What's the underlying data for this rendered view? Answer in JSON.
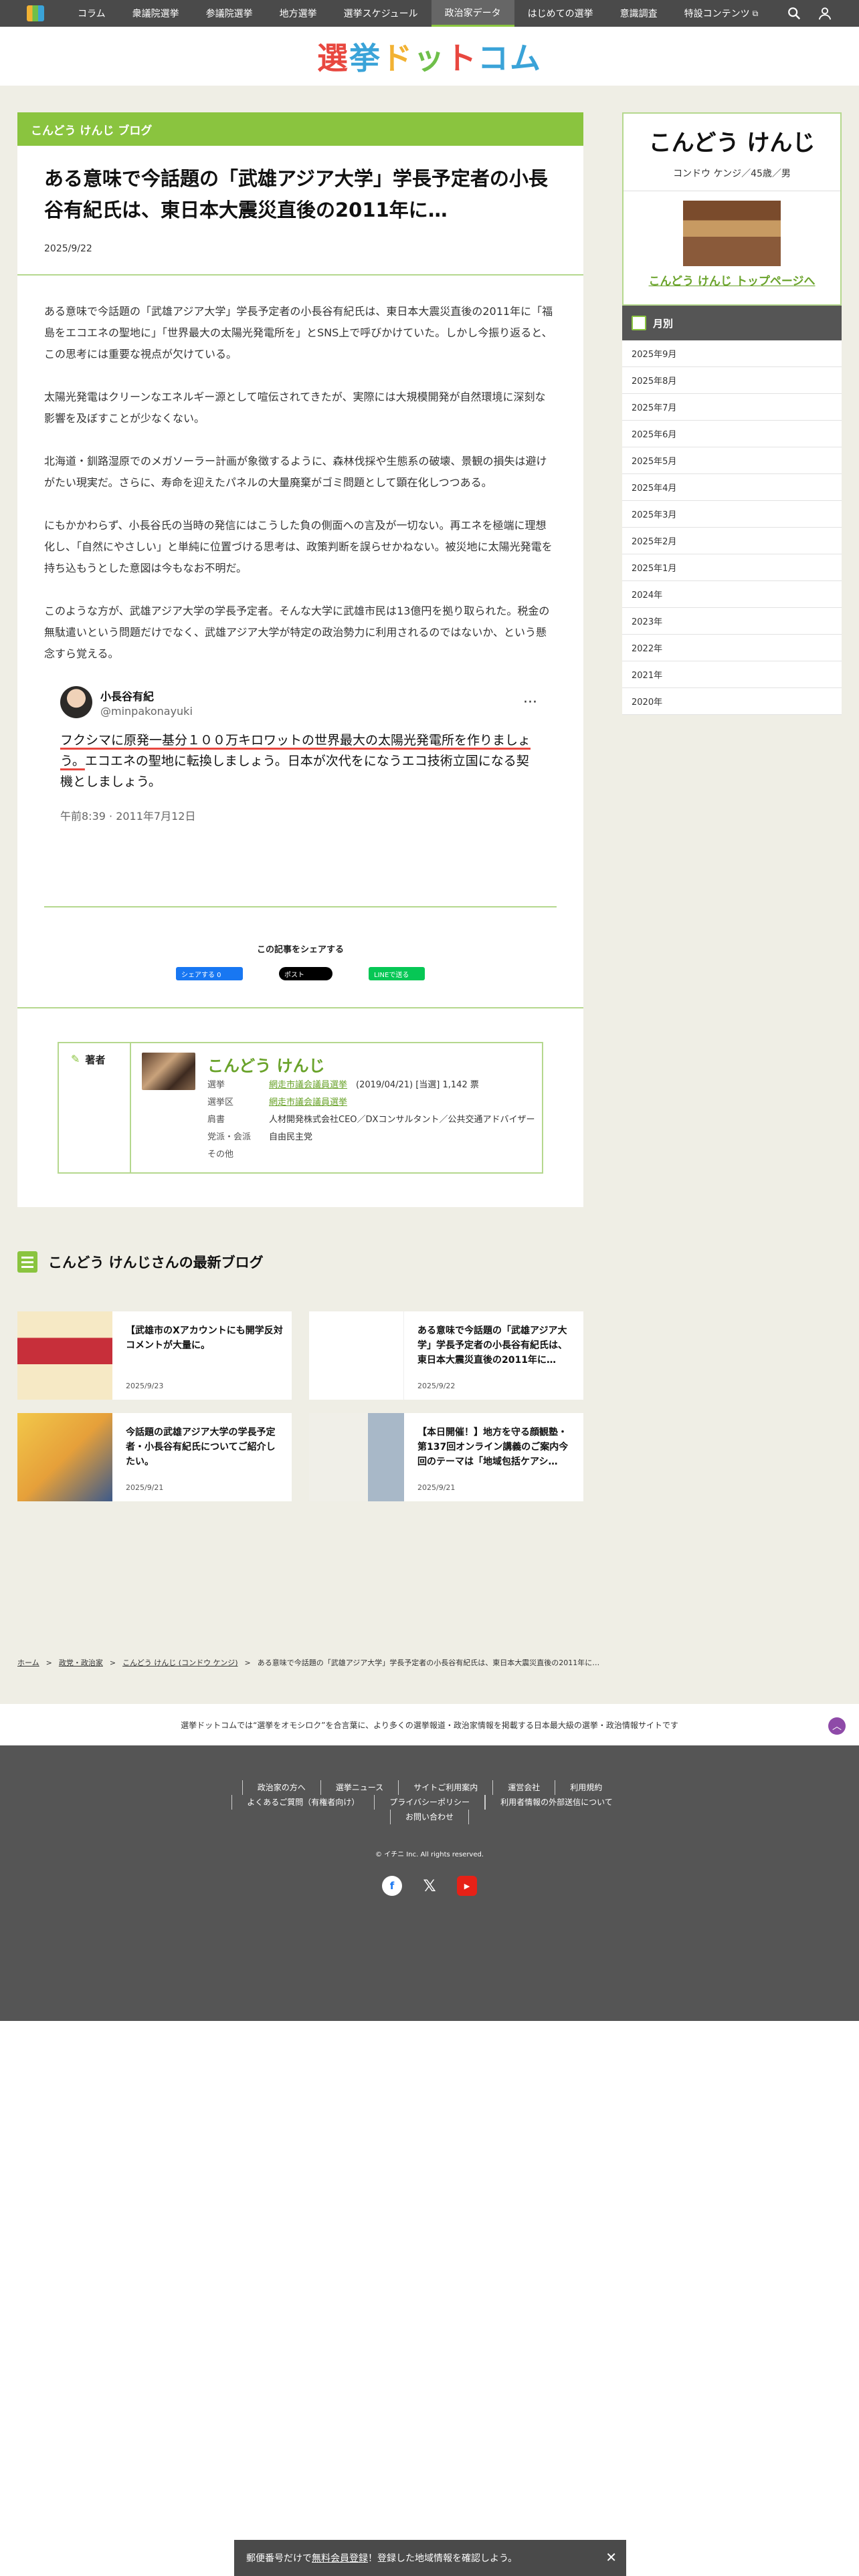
{
  "nav": {
    "items": [
      "コラム",
      "衆議院選挙",
      "参議院選挙",
      "地方選挙",
      "選挙スケジュール",
      "政治家データ",
      "はじめての選挙",
      "意識調査",
      "特設コンテンツ"
    ],
    "active_index": 5
  },
  "header": {
    "logo_chars": [
      "選",
      "挙",
      "ド",
      "ッ",
      "ト",
      "コム"
    ]
  },
  "article": {
    "blog_label": "こんどう けんじ ブログ",
    "title": "ある意味で今話題の「武雄アジア大学」学長予定者の小長谷有紀氏は、東日本大震災直後の2011年に…",
    "date": "2025/9/22",
    "paragraphs": [
      "ある意味で今話題の「武雄アジア大学」学長予定者の小長谷有紀氏は、東日本大震災直後の2011年に「福島をエコエネの聖地に」「世界最大の太陽光発電所を」とSNS上で呼びかけていた。しかし今振り返ると、この思考には重要な視点が欠けている。",
      "太陽光発電はクリーンなエネルギー源として喧伝されてきたが、実際には大規模開発が自然環境に深刻な影響を及ぼすことが少なくない。",
      "北海道・釧路湿原でのメガソーラー計画が象徴するように、森林伐採や生態系の破壊、景観の損失は避けがたい現実だ。さらに、寿命を迎えたパネルの大量廃棄がゴミ問題として顕在化しつつある。",
      "にもかかわらず、小長谷氏の当時の発信にはこうした負の側面への言及が一切ない。再エネを極端に理想化し、「自然にやさしい」と単純に位置づける思考は、政策判断を誤らせかねない。被災地に太陽光発電を持ち込もうとした意図は今もなお不明だ。",
      "このような方が、武雄アジア大学の学長予定者。そんな大学に武雄市民は13億円を拠り取られた。税金の無駄遣いという問題だけでなく、武雄アジア大学が特定の政治勢力に利用されるのではないか、という懸念すら覚える。"
    ]
  },
  "tweet": {
    "name": "小長谷有紀",
    "handle": "@minpakonayuki",
    "text_highlight": "フクシマに原発一基分１００万キロワットの世界最大の太陽光発電所を作りましょう。",
    "text_rest": "エコエネの聖地に転換しましょう。日本が次代をになうエコ技術立国になる契機としましょう。",
    "time": "午前8:39 · 2011年7月12日",
    "more": "···"
  },
  "share": {
    "title": "この記事をシェアする",
    "facebook": "シェアする 0",
    "x": "ポスト",
    "line": "LINEで送る"
  },
  "author": {
    "label": "著者",
    "name": "こんどう けんじ",
    "rows": [
      {
        "key": "選挙",
        "link": "網走市議会議員選挙",
        "rest": "(2019/04/21) [当選] 1,142 票"
      },
      {
        "key": "選挙区",
        "link": "網走市議会議員選挙",
        "rest": ""
      },
      {
        "key": "肩書",
        "link": "",
        "rest": "人材開発株式会社CEO／DXコンサルタント／公共交通アドバイザー"
      },
      {
        "key": "党派・会派",
        "link": "",
        "rest": "自由民主党"
      },
      {
        "key": "その他",
        "link": "",
        "rest": ""
      }
    ]
  },
  "latest": {
    "title": "こんどう けんじさんの最新ブログ",
    "cards": [
      {
        "title": "【武雄市のXアカウントにも開学反対コメントが大量に。",
        "date": "2025/9/23"
      },
      {
        "title": "ある意味で今話題の「武雄アジア大学」学長予定者の小長谷有紀氏は、東日本大震災直後の2011年に…",
        "date": "2025/9/22"
      },
      {
        "title": "今話題の武雄アジア大学の学長予定者・小長谷有紀氏についてご紹介したい。",
        "date": "2025/9/21"
      },
      {
        "title": "【本日開催！】地方を守る顔観塾・第137回オンライン講義のご案内今回のテーマは「地域包括ケアシ…",
        "date": "2025/9/21"
      }
    ]
  },
  "breadcrumb": [
    "ホーム",
    "政党・政治家",
    "こんどう けんじ (コンドウ ケンジ)",
    "ある意味で今話題の「武雄アジア大学」学長予定者の小長谷有紀氏は、東日本大震災直後の2011年に…"
  ],
  "sidebar": {
    "name": "こんどう けんじ",
    "sub": "コンドウ ケンジ／45歳／男",
    "top_link": "こんどう けんじ トップページへ",
    "month_title": "月別",
    "months": [
      "2025年9月",
      "2025年8月",
      "2025年7月",
      "2025年6月",
      "2025年5月",
      "2025年4月",
      "2025年3月",
      "2025年2月",
      "2025年1月",
      "2024年",
      "2023年",
      "2022年",
      "2021年",
      "2020年"
    ]
  },
  "footer": {
    "tagline": "選挙ドットコムでは“選挙をオモシロク”を合言葉に、より多くの選挙報道・政治家情報を掲載する日本最大級の選挙・政治情報サイトです",
    "to_top": "︿",
    "links": [
      "政治家の方へ",
      "選挙ニュース",
      "サイトご利用案内",
      "運営会社",
      "利用規約",
      "よくあるご質問（有権者向け）",
      "プライバシーポリシー",
      "利用者情報の外部送信について",
      "お問い合わせ"
    ],
    "copyright": "© イチニ Inc. All rights reserved.",
    "social": {
      "facebook": "f",
      "x": "𝕏",
      "youtube": "▶"
    }
  },
  "banner": {
    "text_before": "郵便番号だけで",
    "text_link": "無料会員登録",
    "text_after": "！登録した地域情報を確認しよう。",
    "close": "✕"
  }
}
